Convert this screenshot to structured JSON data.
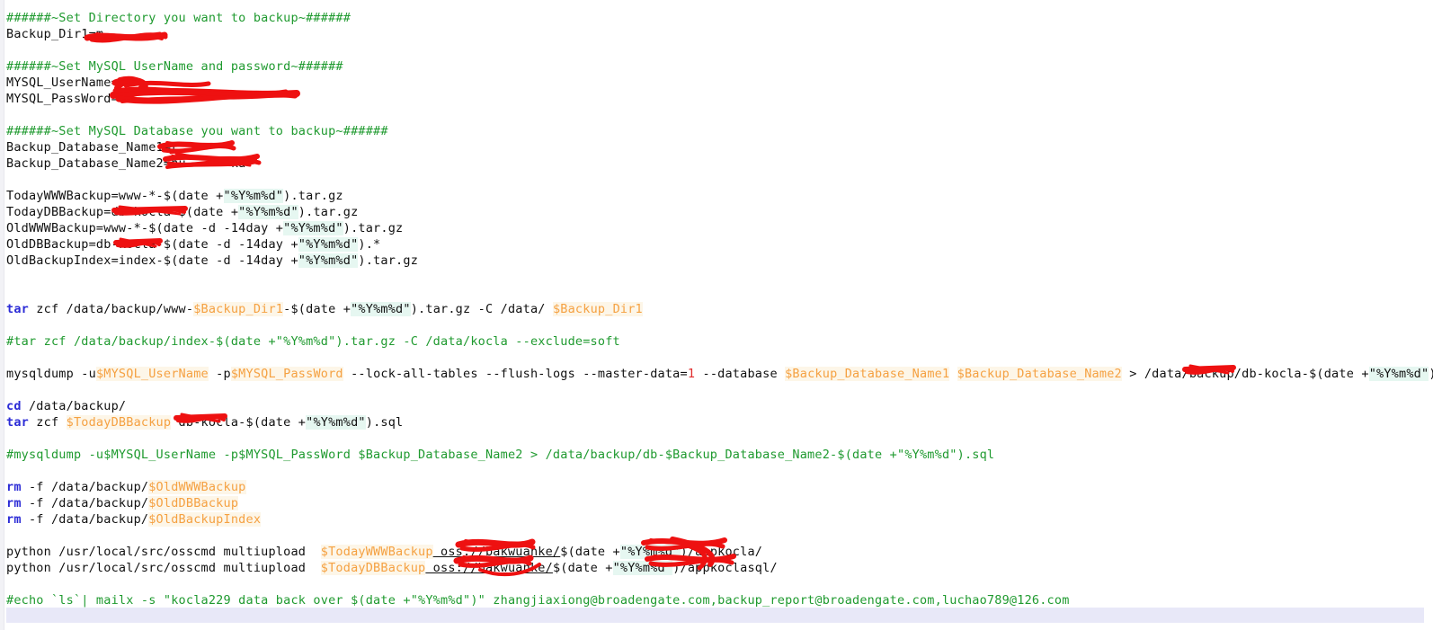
{
  "document": {
    "kind": "shell-script-viewer",
    "background_color": "#ffffff",
    "accent_colors": {
      "comment": "#1f9a2f",
      "keyword": "#2b2bd6",
      "variable": "#f5a142",
      "variable_background": "#fdf6e8",
      "number": "#e02b2b",
      "string_highlight": "#e6f7f1",
      "redaction": "#ee1111",
      "cursor_line": "#e8e8f8",
      "text": "#101010"
    }
  },
  "code": {
    "lines": [
      {
        "id": "l1",
        "type": "comment",
        "text": "######~Set Directory you want to backup~######"
      },
      {
        "id": "l2",
        "type": "assign",
        "text": "Backup_Dir1=m",
        "redacted": true
      },
      {
        "id": "l3",
        "type": "blank",
        "text": ""
      },
      {
        "id": "l4",
        "type": "comment",
        "text": "######~Set MySQL UserName and password~######"
      },
      {
        "id": "l5",
        "type": "assign",
        "text": "MYSQL_UserName=",
        "redacted": true
      },
      {
        "id": "l6",
        "type": "assign",
        "text": "MYSQL_PassWord=",
        "redacted": true
      },
      {
        "id": "l7",
        "type": "blank",
        "text": ""
      },
      {
        "id": "l8",
        "type": "comment",
        "text": "######~Set MySQL Database you want to backup~######"
      },
      {
        "id": "l9",
        "type": "assign",
        "text": "Backup_Database_Name1=r",
        "redacted": true
      },
      {
        "id": "l10",
        "type": "assign",
        "text": "Backup_Database_Name2=nu          ka",
        "redacted": true
      },
      {
        "id": "l11",
        "type": "blank",
        "text": ""
      },
      {
        "id": "l12",
        "type": "assign",
        "text": "TodayWWWBackup=www-*-$(date +\"%Y%m%d\").tar.gz"
      },
      {
        "id": "l13",
        "type": "assign",
        "text": "TodayDBBackup=db-kocla-$(date +\"%Y%m%d\").tar.gz",
        "redacted": true
      },
      {
        "id": "l14",
        "type": "assign",
        "text": "OldWWWBackup=www-*-$(date -d -14day +\"%Y%m%d\").tar.gz"
      },
      {
        "id": "l15",
        "type": "assign",
        "text": "OldDBBackup=db-kocla-$(date -d -14day +\"%Y%m%d\").*",
        "redacted": true
      },
      {
        "id": "l16",
        "type": "assign",
        "text": "OldBackupIndex=index-$(date -d -14day +\"%Y%m%d\").tar.gz"
      },
      {
        "id": "l17",
        "type": "blank",
        "text": ""
      },
      {
        "id": "l18",
        "type": "blank",
        "text": ""
      },
      {
        "id": "l19",
        "type": "command",
        "text": "tar zcf /data/backup/www-$Backup_Dir1-$(date +\"%Y%m%d\").tar.gz -C /data/ $Backup_Dir1"
      },
      {
        "id": "l20",
        "type": "blank",
        "text": ""
      },
      {
        "id": "l21",
        "type": "comment",
        "text": "#tar zcf /data/backup/index-$(date +\"%Y%m%d\").tar.gz -C /data/kocla --exclude=soft"
      },
      {
        "id": "l22",
        "type": "blank",
        "text": ""
      },
      {
        "id": "l23",
        "type": "command",
        "text": "mysqldump -u$MYSQL_UserName -p$MYSQL_PassWord --lock-all-tables --flush-logs --master-data=1 --database $Backup_Database_Name1 $Backup_Database_Name2 > /data/backup/db-kocla-$(date +\"%Y%m%d\").sql",
        "redacted": true
      },
      {
        "id": "l24",
        "type": "blank",
        "text": ""
      },
      {
        "id": "l25",
        "type": "command",
        "text": "cd /data/backup/"
      },
      {
        "id": "l26",
        "type": "command",
        "text": "tar zcf $TodayDBBackup db-kocla-$(date +\"%Y%m%d\").sql",
        "redacted": true
      },
      {
        "id": "l27",
        "type": "blank",
        "text": ""
      },
      {
        "id": "l28",
        "type": "comment",
        "text": "#mysqldump -u$MYSQL_UserName -p$MYSQL_PassWord $Backup_Database_Name2 > /data/backup/db-$Backup_Database_Name2-$(date +\"%Y%m%d\").sql"
      },
      {
        "id": "l29",
        "type": "blank",
        "text": ""
      },
      {
        "id": "l30",
        "type": "command",
        "text": "rm -f /data/backup/$OldWWWBackup"
      },
      {
        "id": "l31",
        "type": "command",
        "text": "rm -f /data/backup/$OldDBBackup"
      },
      {
        "id": "l32",
        "type": "command",
        "text": "rm -f /data/backup/$OldBackupIndex"
      },
      {
        "id": "l33",
        "type": "blank",
        "text": ""
      },
      {
        "id": "l34",
        "type": "command",
        "text": "python /usr/local/src/osscmd multiupload  $TodayWWWBackup oss://bakwuanke/$(date +\"%Y%m%d\")/appkocla/",
        "redacted": true
      },
      {
        "id": "l35",
        "type": "command",
        "text": "python /usr/local/src/osscmd multiupload  $TodayDBBackup oss://bakwuanke/$(date +\"%Y%m%d\")/appkoclasql/",
        "redacted": true
      },
      {
        "id": "l36",
        "type": "blank",
        "text": ""
      },
      {
        "id": "l37",
        "type": "comment",
        "text": "#echo `ls`| mailx -s \"kocla229 data back over $(date +\"%Y%m%d\")\" zhangjiaxiong@broadengate.com,backup_report@broadengate.com,luchao789@126.com"
      },
      {
        "id": "l38",
        "type": "blank",
        "text": ""
      }
    ]
  },
  "tokens": {
    "l1": [
      {
        "c": "cmt",
        "t": "######~Set Directory you want to backup~######"
      }
    ],
    "l2": [
      {
        "c": "plain",
        "t": "Backup_Dir1=m"
      },
      {
        "c": "plain",
        "t": "            "
      }
    ],
    "l4": [
      {
        "c": "cmt",
        "t": "######~Set MySQL UserName and password~######"
      }
    ],
    "l5": [
      {
        "c": "plain",
        "t": "MYSQL_UserName="
      }
    ],
    "l6": [
      {
        "c": "plain",
        "t": "MYSQL_PassWord="
      }
    ],
    "l8": [
      {
        "c": "cmt",
        "t": "######~Set MySQL Database you want to backup~######"
      }
    ],
    "l9": [
      {
        "c": "plain",
        "t": "Backup_Database_Name1=r"
      },
      {
        "c": "plain",
        "t": "        "
      }
    ],
    "l10": [
      {
        "c": "plain",
        "t": "Backup_Database_Name2=nu"
      },
      {
        "c": "plain",
        "t": "      ka"
      }
    ],
    "l12": [
      {
        "c": "plain",
        "t": "TodayWWWBackup=www-*-$(date +"
      },
      {
        "c": "hl",
        "t": "\"%Y%m%d\""
      },
      {
        "c": "plain",
        "t": ").tar.gz"
      }
    ],
    "l13": [
      {
        "c": "plain",
        "t": "TodayDBBackup=db-kocla-$(date +"
      },
      {
        "c": "hl",
        "t": "\"%Y%m%d\""
      },
      {
        "c": "plain",
        "t": ").tar.gz"
      }
    ],
    "l14": [
      {
        "c": "plain",
        "t": "OldWWWBackup=www-*-$(date -d -14day +"
      },
      {
        "c": "hl",
        "t": "\"%Y%m%d\""
      },
      {
        "c": "plain",
        "t": ").tar.gz"
      }
    ],
    "l15": [
      {
        "c": "plain",
        "t": "OldDBBackup=db-kocla-$(date -d -14day +"
      },
      {
        "c": "hl",
        "t": "\"%Y%m%d\""
      },
      {
        "c": "plain",
        "t": ").*"
      }
    ],
    "l16": [
      {
        "c": "plain",
        "t": "OldBackupIndex=index-$(date -d -14day +"
      },
      {
        "c": "hl",
        "t": "\"%Y%m%d\""
      },
      {
        "c": "plain",
        "t": ").tar.gz"
      }
    ],
    "l19": [
      {
        "c": "kw",
        "t": "tar"
      },
      {
        "c": "plain",
        "t": " zcf /data/backup/www-"
      },
      {
        "c": "var",
        "t": "$Backup_Dir1"
      },
      {
        "c": "plain",
        "t": "-$(date +"
      },
      {
        "c": "hl",
        "t": "\"%Y%m%d\""
      },
      {
        "c": "plain",
        "t": ").tar.gz -C /data/ "
      },
      {
        "c": "var",
        "t": "$Backup_Dir1"
      }
    ],
    "l21": [
      {
        "c": "cmt",
        "t": "#tar zcf /data/backup/index-$(date +\"%Y%m%d\").tar.gz -C /data/kocla --exclude=soft"
      }
    ],
    "l23": [
      {
        "c": "plain",
        "t": "mysqldump -u"
      },
      {
        "c": "var",
        "t": "$MYSQL_UserName"
      },
      {
        "c": "plain",
        "t": " -p"
      },
      {
        "c": "var",
        "t": "$MYSQL_PassWord"
      },
      {
        "c": "plain",
        "t": " --lock-all-tables --flush-logs --master-data="
      },
      {
        "c": "num",
        "t": "1"
      },
      {
        "c": "plain",
        "t": " --database "
      },
      {
        "c": "var",
        "t": "$Backup_Database_Name1"
      },
      {
        "c": "plain",
        "t": " "
      },
      {
        "c": "var",
        "t": "$Backup_Database_Name2"
      },
      {
        "c": "plain",
        "t": " > /data/backup/db-kocla-$(date +"
      },
      {
        "c": "hl",
        "t": "\"%Y%m%d\""
      },
      {
        "c": "plain",
        "t": ").sql"
      }
    ],
    "l25": [
      {
        "c": "kw",
        "t": "cd"
      },
      {
        "c": "plain",
        "t": " /data/backup/"
      }
    ],
    "l26": [
      {
        "c": "kw",
        "t": "tar"
      },
      {
        "c": "plain",
        "t": " zcf "
      },
      {
        "c": "var",
        "t": "$TodayDBBackup"
      },
      {
        "c": "plain",
        "t": " db-kocla-$(date +"
      },
      {
        "c": "hl",
        "t": "\"%Y%m%d\""
      },
      {
        "c": "plain",
        "t": ").sql"
      }
    ],
    "l28": [
      {
        "c": "cmt",
        "t": "#mysqldump -u$MYSQL_UserName -p$MYSQL_PassWord $Backup_Database_Name2 > /data/backup/db-$Backup_Database_Name2-$(date +\"%Y%m%d\").sql"
      }
    ],
    "l30": [
      {
        "c": "kw",
        "t": "rm"
      },
      {
        "c": "plain",
        "t": " -f /data/backup/"
      },
      {
        "c": "var",
        "t": "$OldWWWBackup"
      }
    ],
    "l31": [
      {
        "c": "kw",
        "t": "rm"
      },
      {
        "c": "plain",
        "t": " -f /data/backup/"
      },
      {
        "c": "var",
        "t": "$OldDBBackup"
      }
    ],
    "l32": [
      {
        "c": "kw",
        "t": "rm"
      },
      {
        "c": "plain",
        "t": " -f /data/backup/"
      },
      {
        "c": "var",
        "t": "$OldBackupIndex"
      }
    ],
    "l34": [
      {
        "c": "plain",
        "t": "python /usr/local/src/osscmd multiupload  "
      },
      {
        "c": "var",
        "t": "$TodayWWWBackup"
      },
      {
        "c": "plain ul",
        "t": " oss://bakwuanke/"
      },
      {
        "c": "plain",
        "t": "$(date +"
      },
      {
        "c": "hl",
        "t": "\"%Y%m%d\""
      },
      {
        "c": "plain",
        "t": ")/appkocla/"
      }
    ],
    "l35": [
      {
        "c": "plain",
        "t": "python /usr/local/src/osscmd multiupload  "
      },
      {
        "c": "var",
        "t": "$TodayDBBackup"
      },
      {
        "c": "plain ul",
        "t": " oss://bakwuanke/"
      },
      {
        "c": "plain",
        "t": "$(date +"
      },
      {
        "c": "hl",
        "t": "\"%Y%m%d\""
      },
      {
        "c": "plain",
        "t": ")/appkoclasql/"
      }
    ],
    "l37": [
      {
        "c": "cmt",
        "t": "#echo `ls`| mailx -s \"kocla229 data back over $(date +\"%Y%m%d\")\" zhangjiaxiong@broadengate.com,backup_report@broadengate.com,luchao789@126.com"
      }
    ]
  },
  "redactions": [
    {
      "id": "r1",
      "label": "backup-dir-value",
      "line": "l2"
    },
    {
      "id": "r2",
      "label": "mysql-credentials",
      "line": "l5"
    },
    {
      "id": "r3",
      "label": "database-name-1",
      "line": "l9"
    },
    {
      "id": "r4",
      "label": "database-name-2",
      "line": "l10"
    },
    {
      "id": "r5",
      "label": "db-name-today",
      "line": "l13"
    },
    {
      "id": "r6",
      "label": "db-name-old",
      "line": "l15"
    },
    {
      "id": "r7",
      "label": "db-name-dump-path",
      "line": "l23"
    },
    {
      "id": "r8",
      "label": "db-name-tar",
      "line": "l26"
    },
    {
      "id": "r9",
      "label": "oss-bucket-www",
      "line": "l34"
    },
    {
      "id": "r10",
      "label": "oss-bucket-db",
      "line": "l35"
    }
  ]
}
